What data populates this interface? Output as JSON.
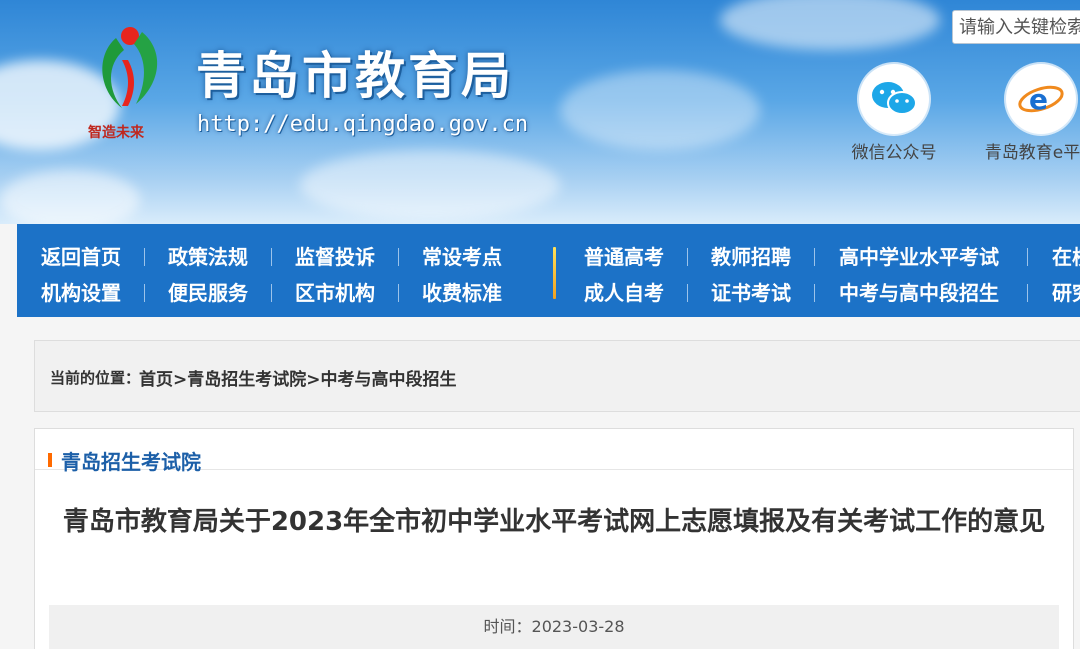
{
  "header": {
    "site_title": "青岛市教育局",
    "site_url": "http://edu.qingdao.gov.cn",
    "logo_motto": "智造未来",
    "search_placeholder": "请输入关键检索",
    "social": [
      {
        "label": "微信公众号",
        "icon": "wechat-icon"
      },
      {
        "label": "青岛教育e平台",
        "icon": "e-platform-icon"
      }
    ]
  },
  "nav": {
    "left_row1": [
      "返回首页",
      "政策法规",
      "监督投诉",
      "常设考点"
    ],
    "left_row2": [
      "机构设置",
      "便民服务",
      "区市机构",
      "收费标准"
    ],
    "right_row1": [
      "普通高考",
      "教师招聘",
      "高中学业水平考试",
      "在校"
    ],
    "right_row2": [
      "成人自考",
      "证书考试",
      "中考与高中段招生",
      "研究"
    ]
  },
  "breadcrumb": {
    "prefix": "当前的位置：",
    "items": [
      "首页",
      "青岛招生考试院",
      "中考与高中段招生"
    ],
    "separator": ">"
  },
  "section": {
    "title": "青岛招生考试院"
  },
  "article": {
    "title": "青岛市教育局关于2023年全市初中学业水平考试网上志愿填报及有关考试工作的意见",
    "date_label": "时间：",
    "date": "2023-03-28"
  },
  "colors": {
    "nav_bg": "#1c72c7",
    "section_accent": "#ff6a00",
    "section_title": "#1c5fa8"
  }
}
